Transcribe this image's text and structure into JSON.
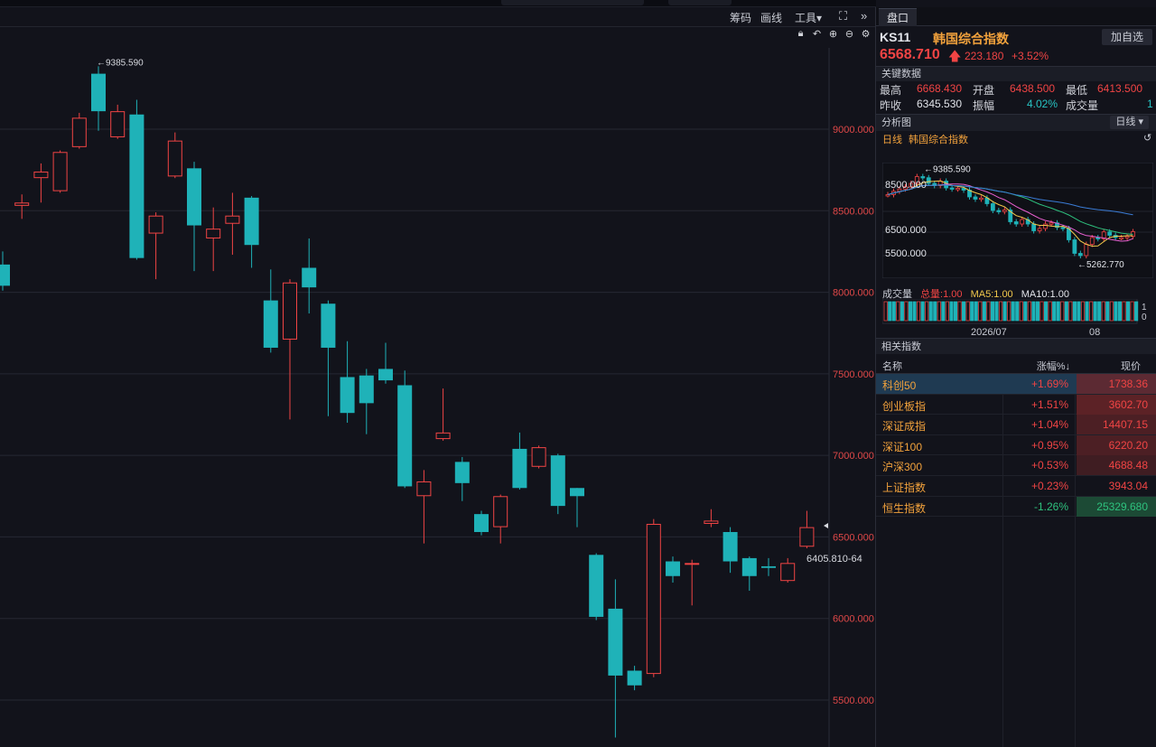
{
  "toolbar": {
    "chips_label": "筹码",
    "draw_label": "画线",
    "tools_label": "工具▾",
    "fullscreen_icon": "fullscreen-icon",
    "expand_icon": "chevrons-right-icon"
  },
  "chart_icons": [
    "lock-icon",
    "undo-icon",
    "zoom-in-icon",
    "zoom-out-icon",
    "gear-icon"
  ],
  "colors": {
    "up": "#f04444",
    "down": "#1fb2b8",
    "accent": "#f2a23c",
    "selected_row": "#1f3a52"
  },
  "chart_data": {
    "type": "candlestick",
    "y_axis": {
      "min": 5500,
      "max": 9000,
      "ticks": [
        "9000.000",
        "8500.000",
        "8000.000",
        "7500.000",
        "7000.000",
        "6500.000",
        "6000.000",
        "5500.000"
      ]
    },
    "annotations": {
      "high_label": "←9385.590",
      "last_label": "6405.810-64"
    },
    "candles": [
      {
        "o": 8170,
        "c": 8040,
        "h": 8250,
        "l": 8010
      },
      {
        "o": 8530,
        "c": 8550,
        "h": 8600,
        "l": 8450
      },
      {
        "o": 8700,
        "c": 8740,
        "h": 8790,
        "l": 8550
      },
      {
        "o": 8620,
        "c": 8860,
        "h": 8870,
        "l": 8610
      },
      {
        "o": 8890,
        "c": 9070,
        "h": 9100,
        "l": 8880
      },
      {
        "o": 9340,
        "c": 9110,
        "h": 9385.59,
        "l": 8990
      },
      {
        "o": 8950,
        "c": 9110,
        "h": 9150,
        "l": 8940
      },
      {
        "o": 9090,
        "c": 8210,
        "h": 9180,
        "l": 8200
      },
      {
        "o": 8360,
        "c": 8470,
        "h": 8490,
        "l": 8080
      },
      {
        "o": 8710,
        "c": 8930,
        "h": 8980,
        "l": 8700
      },
      {
        "o": 8760,
        "c": 8410,
        "h": 8800,
        "l": 8130
      },
      {
        "o": 8330,
        "c": 8390,
        "h": 8520,
        "l": 8130
      },
      {
        "o": 8420,
        "c": 8470,
        "h": 8610,
        "l": 8230
      },
      {
        "o": 8580,
        "c": 8290,
        "h": 8590,
        "l": 8150
      },
      {
        "o": 7950,
        "c": 7660,
        "h": 8140,
        "l": 7630
      },
      {
        "o": 7710,
        "c": 8060,
        "h": 8080,
        "l": 7220
      },
      {
        "o": 8150,
        "c": 8030,
        "h": 8330,
        "l": 7870
      },
      {
        "o": 7930,
        "c": 7660,
        "h": 7950,
        "l": 7240
      },
      {
        "o": 7480,
        "c": 7260,
        "h": 7700,
        "l": 7200
      },
      {
        "o": 7490,
        "c": 7320,
        "h": 7530,
        "l": 7130
      },
      {
        "o": 7530,
        "c": 7460,
        "h": 7690,
        "l": 7440
      },
      {
        "o": 7430,
        "c": 6810,
        "h": 7520,
        "l": 6800
      },
      {
        "o": 6750,
        "c": 6840,
        "h": 6910,
        "l": 6460
      },
      {
        "o": 7100,
        "c": 7140,
        "h": 7410,
        "l": 7090
      },
      {
        "o": 6960,
        "c": 6830,
        "h": 6990,
        "l": 6720
      },
      {
        "o": 6640,
        "c": 6530,
        "h": 6660,
        "l": 6510
      },
      {
        "o": 6560,
        "c": 6750,
        "h": 6760,
        "l": 6460
      },
      {
        "o": 7040,
        "c": 6800,
        "h": 7140,
        "l": 6790
      },
      {
        "o": 6930,
        "c": 7050,
        "h": 7060,
        "l": 6920
      },
      {
        "o": 7000,
        "c": 6690,
        "h": 7010,
        "l": 6640
      },
      {
        "o": 6800,
        "c": 6750,
        "h": 6800,
        "l": 6560
      },
      {
        "o": 6390,
        "c": 6010,
        "h": 6400,
        "l": 5990
      },
      {
        "o": 6060,
        "c": 5650,
        "h": 6240,
        "l": 5270
      },
      {
        "o": 5680,
        "c": 5590,
        "h": 5710,
        "l": 5560
      },
      {
        "o": 5660,
        "c": 6580,
        "h": 6610,
        "l": 5640
      },
      {
        "o": 6350,
        "c": 6260,
        "h": 6380,
        "l": 6220
      },
      {
        "o": 6330,
        "c": 6340,
        "h": 6360,
        "l": 6080
      },
      {
        "o": 6580,
        "c": 6600,
        "h": 6670,
        "l": 6560
      },
      {
        "o": 6530,
        "c": 6350,
        "h": 6560,
        "l": 6280
      },
      {
        "o": 6370,
        "c": 6260,
        "h": 6380,
        "l": 6170
      },
      {
        "o": 6320,
        "c": 6310,
        "h": 6370,
        "l": 6260
      },
      {
        "o": 6230,
        "c": 6340,
        "h": 6370,
        "l": 6220
      },
      {
        "o": 6440,
        "c": 6560,
        "h": 6660,
        "l": 6430
      }
    ]
  },
  "side": {
    "tab_label": "盘口",
    "code": "KS11",
    "name": "韩国综合指数",
    "add_button": "加自选",
    "price": "6568.710",
    "price_arrow": "🡅",
    "change": "223.180",
    "change_pct": "+3.52%",
    "key_data_title": "关键数据",
    "key_rows": [
      [
        {
          "l": "最高",
          "v": "6668.430"
        },
        {
          "l": "开盘",
          "v": "6438.500"
        },
        {
          "l": "最低",
          "v": "6413.500"
        }
      ],
      [
        {
          "l": "昨收",
          "v": "6345.530"
        },
        {
          "l": "振幅",
          "v": "4.02%"
        },
        {
          "l": "成交量",
          "v": "1"
        }
      ]
    ],
    "analysis_title": "分析图",
    "analysis_period": "日线 ▾",
    "mini_period": "日线",
    "mini_name": "韩国综合指数",
    "mini_reset_icon": "reset-icon",
    "mini_chart": {
      "y_ticks": [
        "8500.000",
        "6500.000",
        "5500.000"
      ],
      "high_label": "←9385.590",
      "low_label": "←5262.770"
    },
    "volume": {
      "label": "成交量",
      "total": "总量:1.00",
      "ma5": "MA5:1.00",
      "ma10": "MA10:1.00",
      "x_ticks": [
        "2026/07",
        "08"
      ],
      "y_ticks": [
        "1",
        "0"
      ]
    },
    "related_title": "相关指数",
    "related_head": {
      "name": "名称",
      "pct": "涨幅%↓",
      "price": "现价"
    },
    "related": [
      {
        "name": "科创50",
        "pct": "+1.69%",
        "price": "1738.36",
        "dir": "up"
      },
      {
        "name": "创业板指",
        "pct": "+1.51%",
        "price": "3602.70",
        "dir": "up"
      },
      {
        "name": "深证成指",
        "pct": "+1.04%",
        "price": "14407.15",
        "dir": "up"
      },
      {
        "name": "深证100",
        "pct": "+0.95%",
        "price": "6220.20",
        "dir": "up"
      },
      {
        "name": "沪深300",
        "pct": "+0.53%",
        "price": "4688.48",
        "dir": "up"
      },
      {
        "name": "上证指数",
        "pct": "+0.23%",
        "price": "3943.04",
        "dir": "up"
      },
      {
        "name": "恒生指数",
        "pct": "-1.26%",
        "price": "25329.680",
        "dir": "down"
      }
    ]
  }
}
